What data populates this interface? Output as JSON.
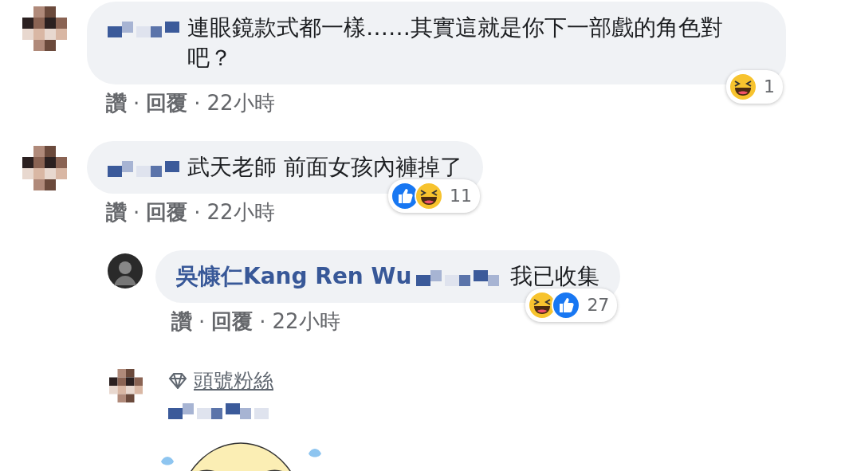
{
  "comments": [
    {
      "text": "連眼鏡款式都一樣……其實這就是你下一部戲的角色對吧？",
      "reactions": [
        {
          "kind": "haha"
        }
      ],
      "reaction_count": "1",
      "actions": [
        "讚",
        "回覆",
        "22小時"
      ]
    },
    {
      "text": "武天老師 前面女孩內褲掉了",
      "reactions": [
        {
          "kind": "like"
        },
        {
          "kind": "haha"
        }
      ],
      "reaction_count": "11",
      "actions": [
        "讚",
        "回覆",
        "22小時"
      ],
      "replies": [
        {
          "author": "吳慷仁Kang Ren Wu",
          "text": "我已收集",
          "reactions": [
            {
              "kind": "haha"
            },
            {
              "kind": "like"
            }
          ],
          "reaction_count": "27",
          "actions": [
            "讚",
            "回覆",
            "22小時"
          ]
        }
      ]
    }
  ],
  "separator": "·",
  "fan_comment": {
    "badge": "頭號粉絲"
  }
}
